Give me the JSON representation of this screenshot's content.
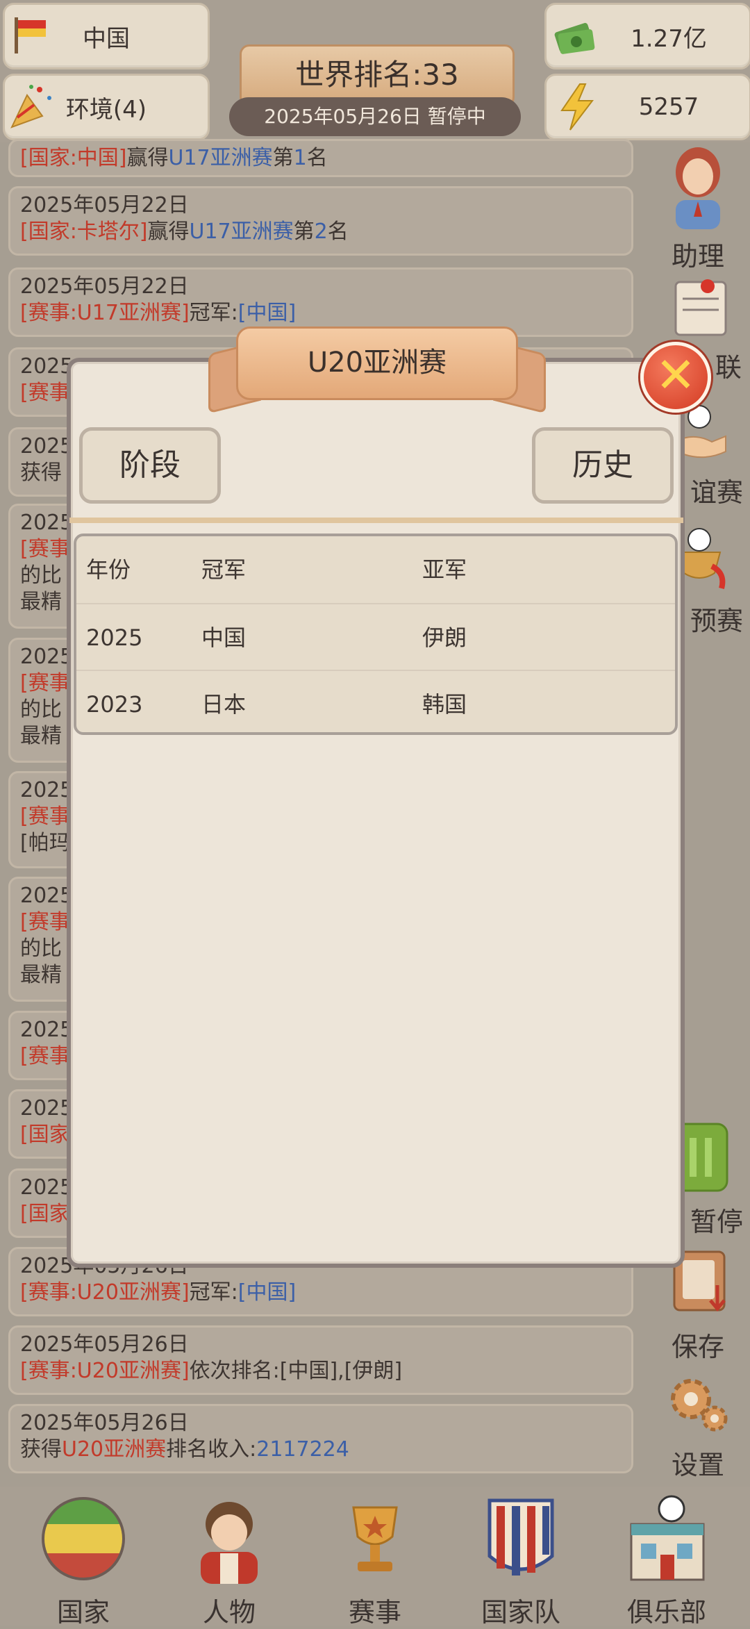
{
  "top": {
    "country": "中国",
    "money": "1.27亿",
    "environment": "环境(4)",
    "energy": "5257",
    "world_rank": "世界排名:33",
    "date_status": "2025年05月26日  暂停中"
  },
  "feed": [
    {
      "date": "",
      "parts": [
        [
          "[国家:中国]",
          "red"
        ],
        [
          "赢得",
          ""
        ],
        [
          "U17亚洲赛",
          "blue"
        ],
        [
          "第",
          ""
        ],
        [
          "1",
          "blue"
        ],
        [
          "名",
          ""
        ]
      ]
    },
    {
      "date": "2025年05月22日",
      "parts": [
        [
          "[国家:卡塔尔]",
          "red"
        ],
        [
          "赢得",
          ""
        ],
        [
          "U17亚洲赛",
          "blue"
        ],
        [
          "第",
          ""
        ],
        [
          "2",
          "blue"
        ],
        [
          "名",
          ""
        ]
      ]
    },
    {
      "date": "2025年05月22日",
      "parts": [
        [
          "[赛事:U17亚洲赛]",
          "red"
        ],
        [
          "冠军:",
          ""
        ],
        [
          "[中国]",
          "blue"
        ]
      ]
    },
    {
      "date": "2025",
      "parts": [
        [
          "[赛事",
          "red"
        ]
      ]
    },
    {
      "date": "2025",
      "parts": [
        [
          "获得",
          ""
        ]
      ]
    },
    {
      "date": "2025",
      "parts": [
        [
          "[赛事",
          "red"
        ]
      ],
      "extra": [
        "的比",
        "最精"
      ]
    },
    {
      "date": "2025",
      "parts": [
        [
          "[赛事",
          "red"
        ]
      ],
      "extra": [
        "的比",
        "最精"
      ]
    },
    {
      "date": "2025",
      "parts": [
        [
          "[赛事",
          "red"
        ]
      ],
      "extra": [
        "[帕玛"
      ]
    },
    {
      "date": "2025",
      "parts": [
        [
          "[赛事",
          "red"
        ]
      ],
      "extra": [
        "的比",
        "最精"
      ]
    },
    {
      "date": "2025",
      "parts": [
        [
          "[赛事",
          "red"
        ]
      ]
    },
    {
      "date": "2025",
      "parts": [
        [
          "[国家",
          "red"
        ]
      ]
    },
    {
      "date": "2025",
      "parts": [
        [
          "[国家",
          "red"
        ]
      ]
    },
    {
      "date": "2025年05月26日",
      "parts": [
        [
          "[赛事:U20亚洲赛]",
          "red"
        ],
        [
          "冠军:",
          ""
        ],
        [
          "[中国]",
          "blue"
        ]
      ]
    },
    {
      "date": "2025年05月26日",
      "parts": [
        [
          "[赛事:U20亚洲赛]",
          "red"
        ],
        [
          "依次排名:[中国],[伊朗]",
          ""
        ]
      ]
    },
    {
      "date": "2025年05月26日",
      "parts": [
        [
          "获得",
          ""
        ],
        [
          "U20亚洲赛",
          "red"
        ],
        [
          "排名收入:",
          ""
        ],
        [
          "2117224",
          "blue"
        ]
      ]
    }
  ],
  "sidebar": {
    "assistant": "助理",
    "league_partial": "联",
    "friendly_partial": "谊赛",
    "qualifier_partial": "预赛",
    "pause_partial": "暂停",
    "save": "保存",
    "settings": "设置"
  },
  "modal": {
    "title": "U20亚洲赛",
    "btn_stage": "阶段",
    "btn_history": "历史",
    "table": {
      "headers": [
        "年份",
        "冠军",
        "亚军"
      ],
      "rows": [
        [
          "2025",
          "中国",
          "伊朗"
        ],
        [
          "2023",
          "日本",
          "韩国"
        ]
      ]
    }
  },
  "nav": {
    "country": "国家",
    "people": "人物",
    "events": "赛事",
    "national_team": "国家队",
    "club": "俱乐部"
  }
}
